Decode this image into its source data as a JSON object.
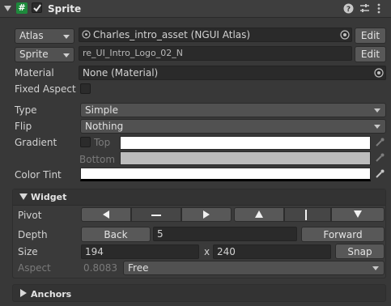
{
  "header": {
    "title": "Sprite",
    "hash_symbol": "#"
  },
  "atlas": {
    "dropdown_label": "Atlas",
    "value": "Charles_intro_asset (NGUI Atlas)",
    "edit_label": "Edit"
  },
  "sprite": {
    "dropdown_label": "Sprite",
    "value": "re_UI_Intro_Logo_02_N",
    "edit_label": "Edit"
  },
  "material": {
    "label": "Material",
    "value": "None (Material)"
  },
  "fixed_aspect": {
    "label": "Fixed Aspect",
    "checked": false
  },
  "type": {
    "label": "Type",
    "value": "Simple"
  },
  "flip": {
    "label": "Flip",
    "value": "Nothing"
  },
  "gradient": {
    "label": "Gradient",
    "top_label": "Top",
    "bottom_label": "Bottom",
    "top_color": "#ffffff",
    "bottom_color": "#bcbcbc"
  },
  "color_tint": {
    "label": "Color Tint",
    "color": "#ffffff"
  },
  "widget": {
    "title": "Widget",
    "pivot_label": "Pivot",
    "depth": {
      "label": "Depth",
      "back_label": "Back",
      "value": "5",
      "forward_label": "Forward"
    },
    "size": {
      "label": "Size",
      "width": "194",
      "x_label": "x",
      "height": "240",
      "snap_label": "Snap"
    },
    "aspect": {
      "label": "Aspect",
      "value": "0.8083",
      "mode": "Free"
    }
  },
  "anchors": {
    "title": "Anchors"
  }
}
